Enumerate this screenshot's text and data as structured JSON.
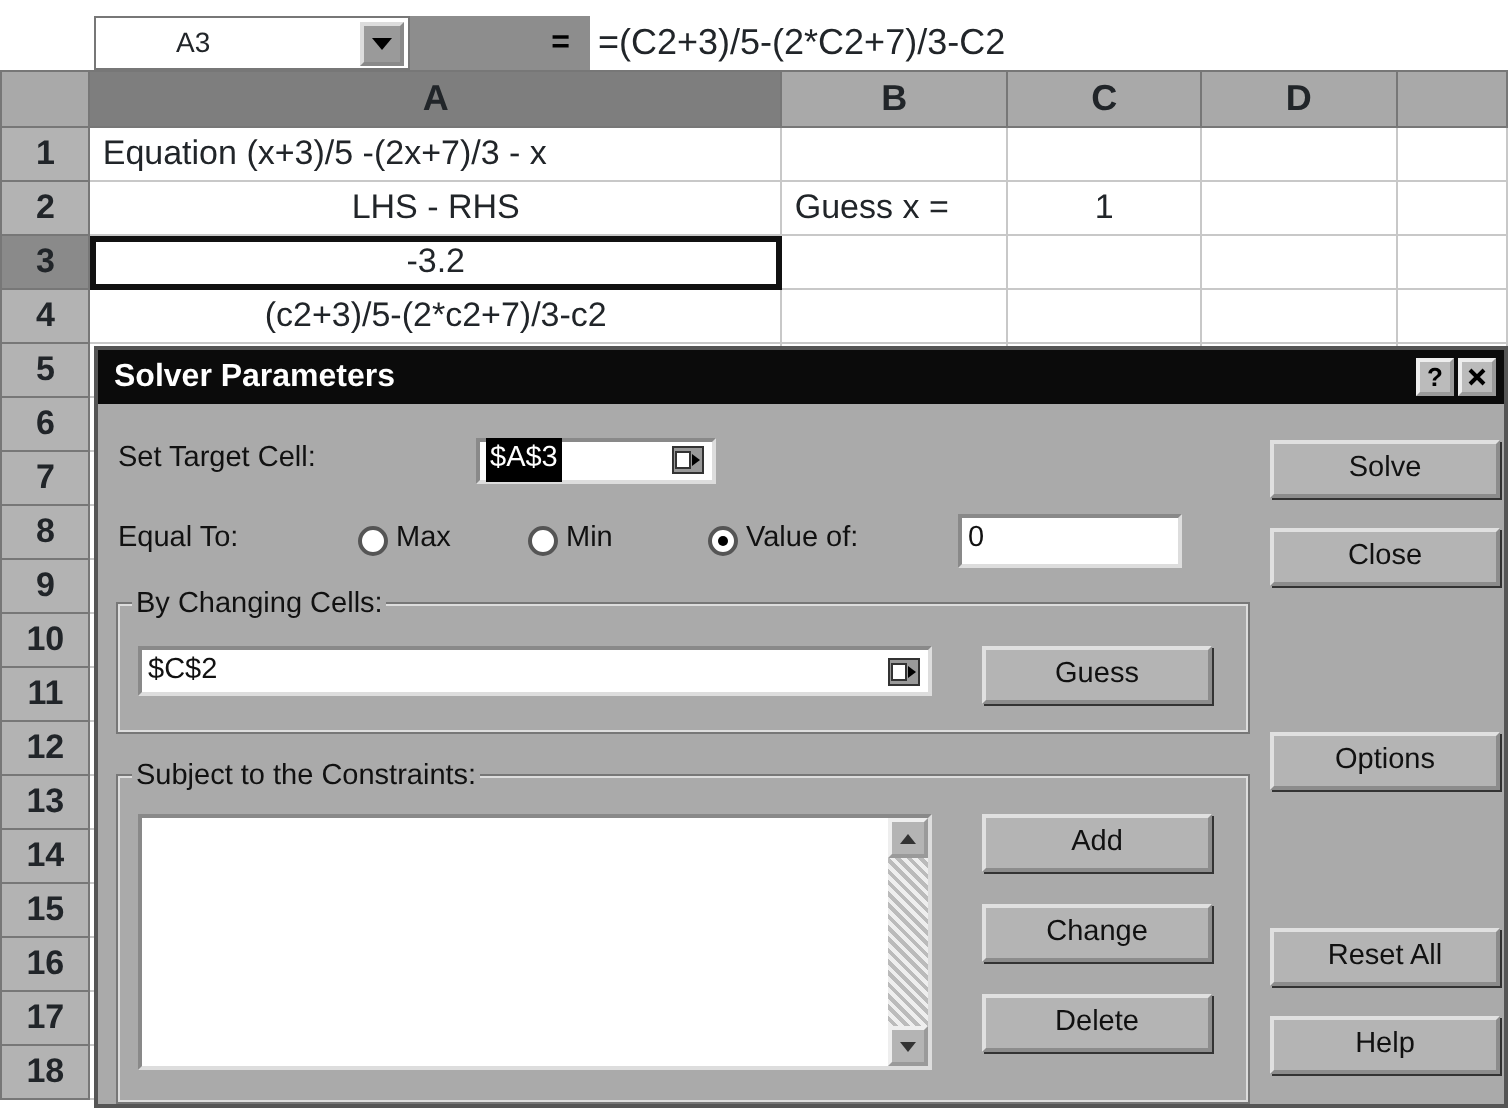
{
  "name_box": "A3",
  "equals": "=",
  "formula": "=(C2+3)/5-(2*C2+7)/3-C2",
  "columns": [
    {
      "label": "A",
      "selected": true
    },
    {
      "label": "B",
      "selected": false
    },
    {
      "label": "C",
      "selected": false
    },
    {
      "label": "D",
      "selected": false
    }
  ],
  "rows": [
    {
      "number": "1",
      "selected": false,
      "cells": [
        {
          "text": "Equation (x+3)/5 -(2x+7)/3 - x",
          "kind": "left",
          "active": false
        }
      ]
    },
    {
      "number": "2",
      "selected": false,
      "cells": [
        {
          "text": "LHS - RHS",
          "kind": "centered",
          "active": false
        },
        {
          "text": "Guess x =",
          "kind": "left",
          "active": false
        },
        {
          "text": "1",
          "kind": "centered",
          "active": false
        }
      ]
    },
    {
      "number": "3",
      "selected": true,
      "cells": [
        {
          "text": "-3.2",
          "kind": "centered",
          "active": true
        }
      ]
    },
    {
      "number": "4",
      "selected": false,
      "cells": [
        {
          "text": "(c2+3)/5-(2*c2+7)/3-c2",
          "kind": "centered",
          "active": false
        }
      ]
    },
    {
      "number": "5",
      "selected": false
    },
    {
      "number": "6",
      "selected": false
    },
    {
      "number": "7",
      "selected": false
    },
    {
      "number": "8",
      "selected": false
    },
    {
      "number": "9",
      "selected": false
    },
    {
      "number": "10",
      "selected": false
    },
    {
      "number": "11",
      "selected": false
    },
    {
      "number": "12",
      "selected": false
    },
    {
      "number": "13",
      "selected": false
    },
    {
      "number": "14",
      "selected": false
    },
    {
      "number": "15",
      "selected": false
    },
    {
      "number": "16",
      "selected": false
    },
    {
      "number": "17",
      "selected": false
    },
    {
      "number": "18",
      "selected": false
    }
  ],
  "dialog": {
    "title": "Solver Parameters",
    "help_button": "?",
    "target_label": "Set Target Cell:",
    "target_value": "$A$3",
    "equal_label": "Equal To:",
    "options": [
      {
        "label": "Max",
        "selected": false
      },
      {
        "label": "Min",
        "selected": false
      },
      {
        "label": "Value of:",
        "selected": true
      }
    ],
    "value_of": "0",
    "changing_label": "By Changing Cells:",
    "changing_value": "$C$2",
    "guess_button": "Guess",
    "constraints_label": "Subject to the Constraints:",
    "constraint_buttons": [
      "Add",
      "Change",
      "Delete"
    ],
    "side_buttons": [
      "Solve",
      "Close",
      "Options",
      "Reset All",
      "Help"
    ]
  }
}
